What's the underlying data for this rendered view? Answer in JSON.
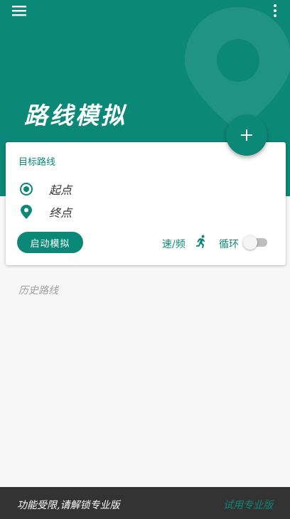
{
  "header": {
    "title": "路线模拟",
    "menu_icon": "hamburger-menu-icon",
    "more_icon": "more-vert-icon"
  },
  "card": {
    "label": "目标路线",
    "start_point": "起点",
    "end_point": "终点",
    "start_button": "启动模拟",
    "speed_label": "速/频",
    "loop_label": "循环",
    "loop_enabled": false
  },
  "fab": {
    "icon": "plus-icon"
  },
  "history": {
    "label": "历史路线"
  },
  "bottom_bar": {
    "message": "功能受限,请解锁专业版",
    "trial_link": "试用专业版"
  },
  "colors": {
    "primary": "#0b8878",
    "bottom_bar": "#333333",
    "background": "#f7f7f7"
  }
}
